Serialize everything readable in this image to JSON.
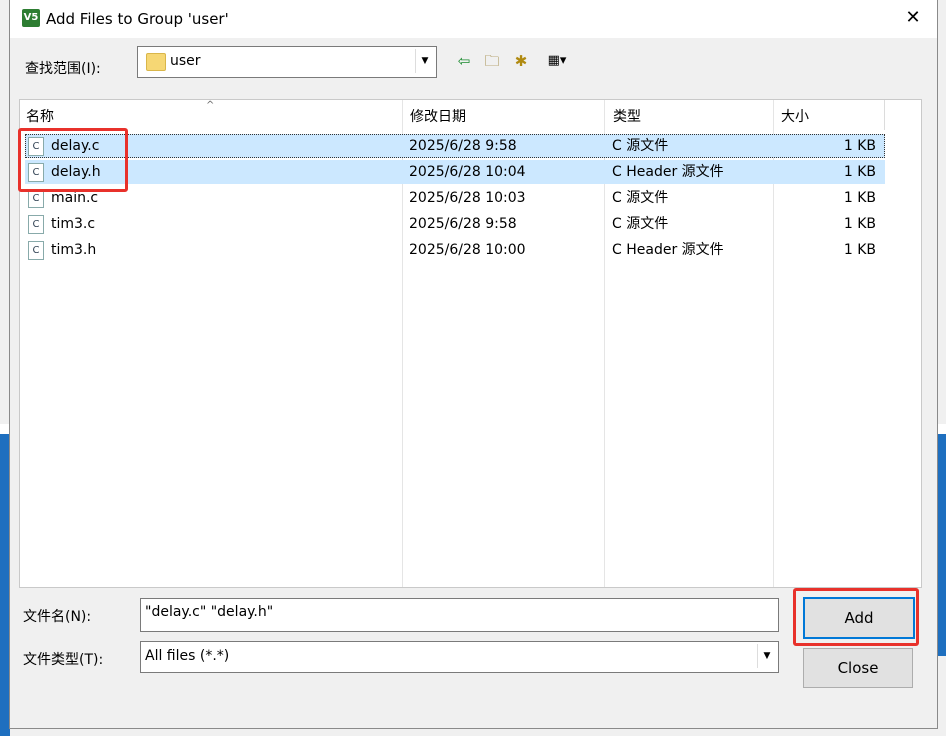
{
  "window": {
    "title": "Add Files to Group 'user'",
    "icon": "V5"
  },
  "toolbar": {
    "lookin_label": "查找范围(I):",
    "lookin_value": "user",
    "icons": [
      "back-arrow-icon",
      "up-folder-icon",
      "new-folder-icon",
      "view-menu-icon"
    ]
  },
  "columns": {
    "name": "名称",
    "modified": "修改日期",
    "type": "类型",
    "size": "大小"
  },
  "files": [
    {
      "name": "delay.c",
      "modified": "2025/6/28 9:58",
      "type": "C 源文件",
      "size": "1 KB",
      "selected": true
    },
    {
      "name": "delay.h",
      "modified": "2025/6/28 10:04",
      "type": "C Header 源文件",
      "size": "1 KB",
      "selected": true
    },
    {
      "name": "main.c",
      "modified": "2025/6/28 10:03",
      "type": "C 源文件",
      "size": "1 KB",
      "selected": false
    },
    {
      "name": "tim3.c",
      "modified": "2025/6/28 9:58",
      "type": "C 源文件",
      "size": "1 KB",
      "selected": false
    },
    {
      "name": "tim3.h",
      "modified": "2025/6/28 10:00",
      "type": "C Header 源文件",
      "size": "1 KB",
      "selected": false
    }
  ],
  "file_icon_glyph": "C",
  "filename": {
    "label": "文件名(N):",
    "value": "\"delay.c\" \"delay.h\""
  },
  "filetype": {
    "label": "文件类型(T):",
    "value": "All files (*.*)"
  },
  "buttons": {
    "add": "Add",
    "close": "Close"
  },
  "highlight_color": "#e8312b",
  "selection_color": "#cce8ff"
}
